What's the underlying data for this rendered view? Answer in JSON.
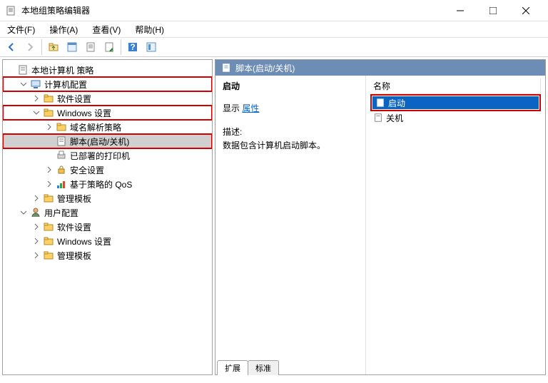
{
  "window": {
    "title": "本地组策略编辑器"
  },
  "menu": {
    "file": "文件(F)",
    "action": "操作(A)",
    "view": "查看(V)",
    "help": "帮助(H)"
  },
  "tree": {
    "root": "本地计算机 策略",
    "computer_config": "计算机配置",
    "software_settings_1": "软件设置",
    "windows_settings_1": "Windows 设置",
    "dns_policy": "域名解析策略",
    "scripts": "脚本(启动/关机)",
    "deployed_printers": "已部署的打印机",
    "security": "安全设置",
    "qos": "基于策略的 QoS",
    "admin_templates_1": "管理模板",
    "user_config": "用户配置",
    "software_settings_2": "软件设置",
    "windows_settings_2": "Windows 设置",
    "admin_templates_2": "管理模板"
  },
  "detail": {
    "header": "脚本(启动/关机)",
    "heading": "启动",
    "show_label": "显示",
    "properties_link": "属性",
    "desc_label": "描述:",
    "desc_text": "数据包含计算机启动脚本。"
  },
  "list": {
    "column_name": "名称",
    "rows": {
      "startup": "启动",
      "shutdown": "关机"
    }
  },
  "tabs": {
    "extended": "扩展",
    "standard": "标准"
  }
}
